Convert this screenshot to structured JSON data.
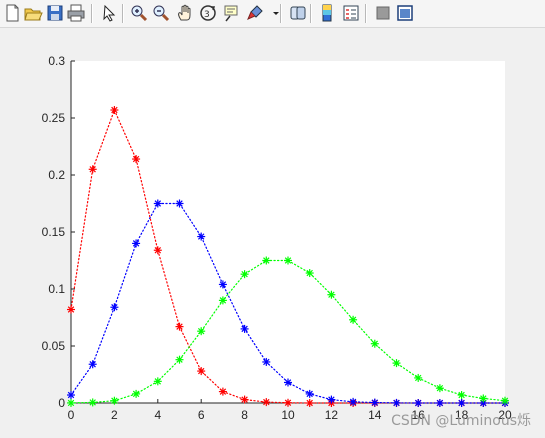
{
  "toolbar": {
    "buttons": [
      {
        "name": "new-figure-icon"
      },
      {
        "name": "open-file-icon"
      },
      {
        "name": "save-figure-icon"
      },
      {
        "name": "print-figure-icon"
      },
      {
        "name": "edit-plot-arrow-icon"
      },
      {
        "name": "zoom-in-icon"
      },
      {
        "name": "zoom-out-icon"
      },
      {
        "name": "pan-hand-icon"
      },
      {
        "name": "rotate-3d-icon"
      },
      {
        "name": "data-cursor-icon"
      },
      {
        "name": "brush-icon"
      },
      {
        "name": "link-plot-icon"
      },
      {
        "name": "colorbar-icon"
      },
      {
        "name": "legend-icon"
      },
      {
        "name": "hide-plot-tools-icon"
      },
      {
        "name": "show-plot-tools-icon"
      }
    ]
  },
  "chart_data": {
    "type": "line",
    "xlim": [
      0,
      20
    ],
    "ylim": [
      0,
      0.3
    ],
    "xticks": [
      "0",
      "2",
      "4",
      "6",
      "8",
      "10",
      "12",
      "14",
      "16",
      "18",
      "20"
    ],
    "yticks": [
      "0",
      "0.05",
      "0.1",
      "0.15",
      "0.2",
      "0.25",
      "0.3"
    ],
    "marker": "asterisk",
    "line_style": "dotted",
    "grid": false,
    "x": [
      0,
      1,
      2,
      3,
      4,
      5,
      6,
      7,
      8,
      9,
      10,
      11,
      12,
      13,
      14,
      15,
      16,
      17,
      18,
      19,
      20
    ],
    "series": [
      {
        "color": "#ff0000",
        "values": [
          0.082,
          0.205,
          0.257,
          0.214,
          0.134,
          0.067,
          0.028,
          0.01,
          0.003,
          0.0008,
          0.0002,
          0,
          0,
          0,
          0,
          0,
          0,
          0,
          0,
          0,
          0
        ]
      },
      {
        "color": "#0000ff",
        "values": [
          0.007,
          0.034,
          0.084,
          0.14,
          0.175,
          0.175,
          0.146,
          0.104,
          0.065,
          0.036,
          0.018,
          0.008,
          0.003,
          0.001,
          0.0004,
          0.0001,
          0,
          0,
          0,
          0,
          0
        ]
      },
      {
        "color": "#00ff00",
        "values": [
          5e-05,
          0.0005,
          0.002,
          0.008,
          0.019,
          0.038,
          0.063,
          0.09,
          0.113,
          0.125,
          0.125,
          0.114,
          0.095,
          0.073,
          0.052,
          0.035,
          0.022,
          0.013,
          0.007,
          0.004,
          0.002
        ]
      }
    ]
  },
  "watermark": {
    "text": "CSDN @Luminous烁"
  }
}
